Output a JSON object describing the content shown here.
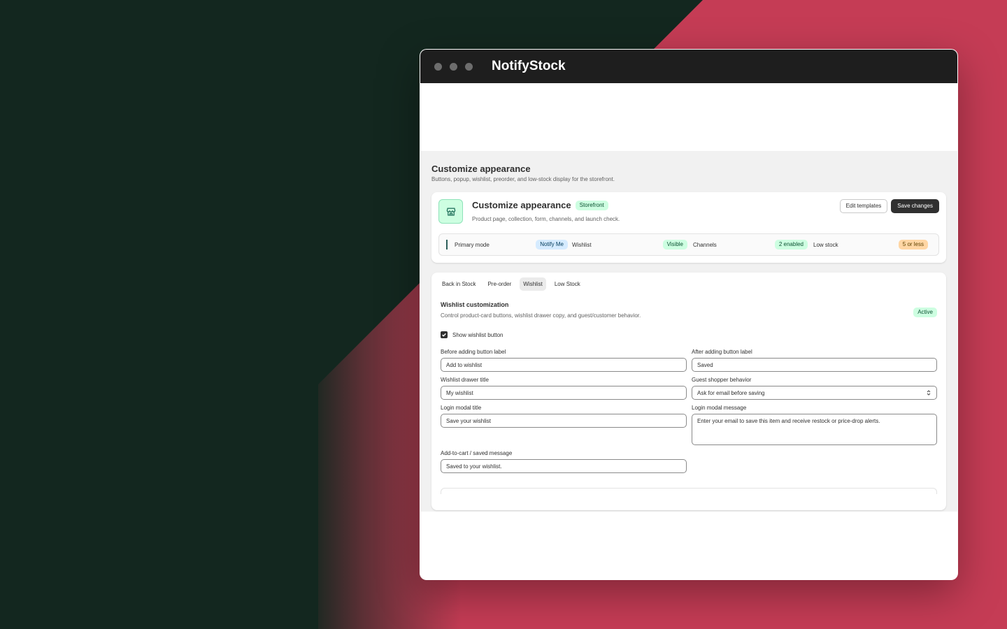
{
  "window": {
    "title": "NotifyStock"
  },
  "page": {
    "title": "Customize appearance",
    "subtitle": "Buttons, popup, wishlist, preorder, and low-stock display for the storefront."
  },
  "header_card": {
    "icon": "store-icon",
    "title": "Customize appearance",
    "badge": "Storefront",
    "subtitle": "Product page, collection, form, channels, and launch check.",
    "edit_label": "Edit templates",
    "save_label": "Save changes",
    "summary": [
      {
        "label": "Primary mode",
        "value": "Notify Me",
        "tone": "blue"
      },
      {
        "label": "Wishlist",
        "value": "Visible",
        "tone": "green"
      },
      {
        "label": "Channels",
        "value": "2 enabled",
        "tone": "green"
      },
      {
        "label": "Low stock",
        "value": "5 or less",
        "tone": "orange"
      }
    ]
  },
  "tabs": [
    {
      "label": "Back in Stock",
      "active": false
    },
    {
      "label": "Pre-order",
      "active": false
    },
    {
      "label": "Wishlist",
      "active": true
    },
    {
      "label": "Low Stock",
      "active": false
    }
  ],
  "wishlist": {
    "title": "Wishlist customization",
    "subtitle": "Control product-card buttons, wishlist drawer copy, and guest/customer behavior.",
    "status": "Active",
    "show_button_label": "Show wishlist button",
    "show_button_checked": true,
    "fields": {
      "before_label": {
        "label": "Before adding button label",
        "value": "Add to wishlist"
      },
      "after_label": {
        "label": "After adding button label",
        "value": "Saved"
      },
      "drawer_title": {
        "label": "Wishlist drawer title",
        "value": "My wishlist"
      },
      "guest_behavior": {
        "label": "Guest shopper behavior",
        "value": "Ask for email before saving"
      },
      "login_title": {
        "label": "Login modal title",
        "value": "Save your wishlist"
      },
      "login_message": {
        "label": "Login modal message",
        "value": "Enter your email to save this item and receive restock or price-drop alerts."
      },
      "saved_message": {
        "label": "Add-to-cart / saved message",
        "value": "Saved to your wishlist."
      }
    }
  },
  "colors": {
    "bg_dark": "#13271f",
    "bg_accent": "#c53c55",
    "titlebar": "#1e1e1e",
    "primary_button": "#303030"
  }
}
